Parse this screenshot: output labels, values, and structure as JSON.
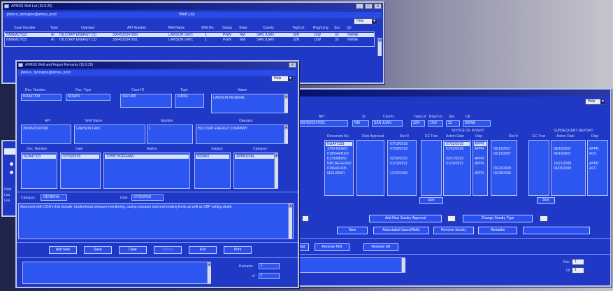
{
  "well_list": {
    "title_bar": "AFMSS Well List (10.9.20)",
    "win_buttons": [
      "_",
      "□",
      "x"
    ],
    "user": "jfeltsco_farrington@afmss_prod",
    "window_title": "Well List",
    "help": "Help",
    "columns": [
      "Case Number",
      "Type",
      "Operator",
      "API Number",
      "Well Name",
      "Well No.",
      "Status",
      "State",
      "County",
      "Twp/Lot",
      "Rng/Long",
      "Sec",
      "Qtr"
    ],
    "rows": [
      [
        "NMNM17033",
        "AI",
        "HILCORP ENERGY CO",
        "3004520347000",
        "LAWSON GWC",
        "1",
        "PGW",
        "NM",
        "SAN JUAN",
        "32N",
        "11W",
        "33",
        "NWNE"
      ],
      [
        "NMNM17033",
        "AI",
        "HILCORP ENERGY CO",
        "3004520347001",
        "LAWSON GWC",
        "1",
        "PGW",
        "NM",
        "SAN JUAN",
        "32N",
        "11W",
        "33",
        "NWNE"
      ]
    ]
  },
  "wr_window": {
    "title_bar": "AFMSS Well and Report Remarks (10.9.20)",
    "user": "jfeltsco_farrington@afmss_prod",
    "help": "Help",
    "doc_number_label": "Doc. Number",
    "doc_number": "NUA47333",
    "doc_type_label": "Doc. Type",
    "doc_type": "NOIAPL",
    "case_id_label": "Case ID",
    "case_id": "SR/1465",
    "type_label": "Type",
    "type": "318311",
    "name_label": "Name",
    "name": "LAWSON FEDERAL",
    "api_label": "API",
    "api": "3004520347000",
    "well_name_label": "Well Name",
    "well_name": "LAWSON GWC",
    "number_label": "Number",
    "number": "1",
    "operator_label": "Operator",
    "operator": "HILCORP ENERGY COMPANY",
    "list_labels": [
      "Doc. Number",
      "Date",
      "Author",
      "Subject",
      "Category"
    ],
    "list_row": [
      "NUA47333",
      "07/20/2018",
      "JOHN HOFFMAN",
      "NOIAPL",
      "APPROVAL"
    ],
    "category_label": "Category",
    "category": "GENERAL",
    "date_label": "Date",
    "date": "07/20/2018",
    "remark": "Approved with COA's that include: bradenhead pressure monitoring, casing pressure test and treating limits as well as CBP setting depth.",
    "buttons": [
      "Add New",
      "Save",
      "Clear",
      "Delete",
      "Exit",
      "Print"
    ],
    "bottom_labels": [
      "Remarks",
      "of"
    ],
    "bottom_values": [
      "1",
      "1"
    ]
  },
  "sundry_window": {
    "help": "Help",
    "top_labels": [
      "API",
      "St",
      "County",
      "Twp/Lot",
      "Rng/Lon",
      "Sec",
      "Qtr"
    ],
    "top_values": [
      "3004520347001",
      "NM",
      "SAN JUAN",
      "32N",
      "11W",
      "33",
      "NWNE"
    ],
    "notice_header": "NOTICE OF INTENT",
    "subsequent_header": "SUBSEQUENT REPORT",
    "col_labels": [
      "Document No.",
      "Date Approval",
      "Rec'd",
      "EC Tran",
      "Action Date",
      "Disp",
      "Rec'd",
      "EC Tran",
      "Action Date",
      "Disp"
    ],
    "doc_col": [
      "NUA47333",
      "1709-NEW01",
      "0180540N115",
      "0176088960",
      "NRCAEGERR2",
      "0196401405",
      "0E0L00051"
    ],
    "recd_col": [
      "07/19/2018",
      "07/09/2018",
      "",
      "03/30/2015",
      "01/19/2011",
      "",
      "12/20/1999"
    ],
    "action_col": [
      "07/23/2018",
      "07/23/2018",
      "",
      "03/27/2015",
      "01/26/2011",
      "",
      ""
    ],
    "disp_col": [
      "APPR",
      "APPR",
      "",
      "APPR",
      "APPR",
      "",
      "APPR"
    ],
    "recd2_col": [
      "08/13/2017",
      "08/13/2007",
      "",
      "",
      "05/21/2008",
      "05/28/2008"
    ],
    "action2_col": [
      "08/18/2007",
      "08/19/2007",
      "",
      "10/21/2008",
      "06/03/2008"
    ],
    "disp2_col": [
      "APPR",
      "ACC",
      "",
      "APPR",
      "ACC"
    ],
    "side_stub": [
      "Date",
      "Lea",
      "Lea"
    ],
    "sort": "Sort",
    "add_sundry": "Add New Sundry Approval",
    "change_type": "Change Sundry Type",
    "mid_buttons": [
      "New",
      "Associated Cases/Wells",
      "Remove Sundry",
      "Remarks"
    ],
    "low_buttons": [
      "Add",
      "Remove NOI",
      "Remove SR"
    ],
    "rec_labels": [
      "Rec",
      "Of"
    ],
    "rec_values": [
      "1",
      "1"
    ]
  },
  "colors": {
    "window": "#1f39c6",
    "field": "#2d55f0",
    "title": "#07106d"
  }
}
